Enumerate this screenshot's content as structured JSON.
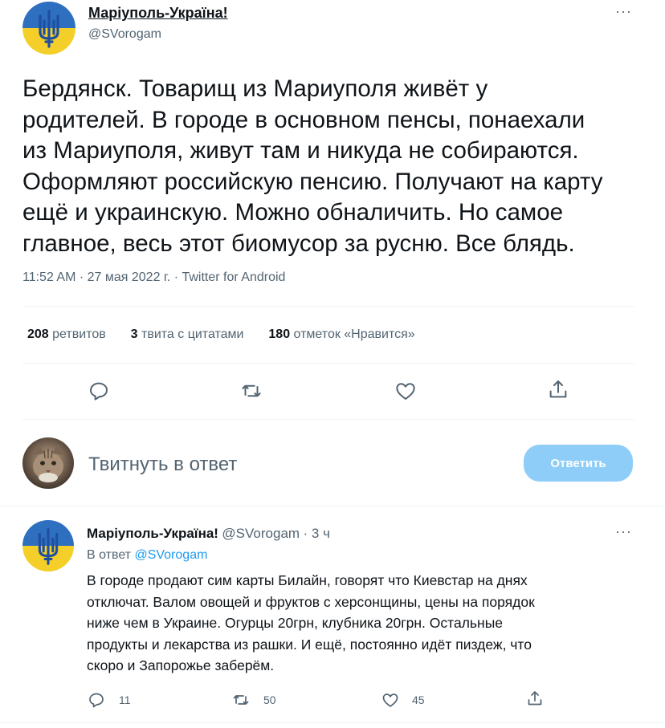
{
  "colors": {
    "accent": "#1d9bf0",
    "flag_blue": "#2f6fc0",
    "flag_yellow": "#f4cf2a",
    "trident": "#1e4fa0",
    "reply_button_disabled": "#8ecdf8"
  },
  "main_tweet": {
    "author_name": "Маріуполь-Україна!",
    "author_handle": "@SVorogam",
    "more_icon": "more-dots-icon",
    "text_lines": [
      "Бердянск. Товарищ из Мариуполя живёт у",
      "родителей. В городе в основном пенсы, понаехали",
      "из Мариуполя, живут там и никуда не собираются.",
      "Оформляют российскую пенсию. Получают на карту",
      "ещё и украинскую. Можно обналичить. Но самое",
      "главное, весь этот биомусор за русню. Все блядь."
    ],
    "timestamp": "11:52 AM · 27 мая 2022 г. · Twitter for Android",
    "stats": {
      "retweets_count": "208",
      "retweets_label": "ретвитов",
      "quotes_count": "3",
      "quotes_label": "твита с цитатами",
      "likes_count": "180",
      "likes_label": "отметок «Нравится»"
    }
  },
  "reply_box": {
    "placeholder": "Твитнуть в ответ",
    "button_label": "Ответить"
  },
  "reply_tweet": {
    "author_name": "Маріуполь-Україна!",
    "author_handle": "@SVorogam",
    "time": "· 3 ч",
    "reply_to_label": "В ответ",
    "reply_to_handle": "@SVorogam",
    "text_lines": [
      "В городе продают сим карты Билайн, говорят что Киевстар  на днях",
      "отключат. Валом овощей и фруктов с херсонщины, цены на порядок",
      "ниже чем в Украине. Огурцы 20грн, клубника 20грн. Остальные",
      "продукты и лекарства из рашки. И ещё, постоянно идёт пиздеж, что",
      "скоро и Запорожье заберём."
    ],
    "reply_count": "11",
    "retweet_count": "50",
    "like_count": "45"
  }
}
